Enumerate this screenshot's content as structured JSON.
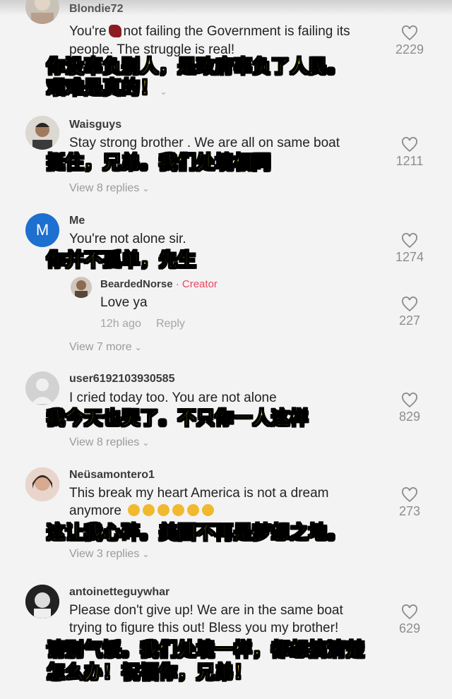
{
  "comments": [
    {
      "username": "Blondie72",
      "text_line1_before": "You're",
      "text_line1_after": "not failing the Government is failing its",
      "text_line2": "people. The struggle is real!",
      "likes": "2229",
      "subtitle_line1": "你没辜负别人，是政府辜负了人民。",
      "subtitle_line2": "艰难是真的！"
    },
    {
      "username": "Waisguys",
      "text_line1": "Stay strong brother . We are all on same boat",
      "likes": "1211",
      "replies_label": "View 8 replies",
      "subtitle_line1": "挺住，兄弟。我们处境相同"
    },
    {
      "username": "Me",
      "avatar_letter": "M",
      "text_line1": "You're not alone sir.",
      "likes": "1274",
      "subtitle_line1": "你并不孤单，先生",
      "reply": {
        "username": "BeardedNorse",
        "separator": " · ",
        "creator_label": "Creator",
        "text": "Love ya",
        "time": "12h ago",
        "reply_action": "Reply",
        "likes": "227"
      },
      "replies_label": "View 7 more"
    },
    {
      "username": "user6192103930585",
      "text_line1": "I cried today too. You are not alone",
      "likes": "829",
      "replies_label": "View 8 replies",
      "subtitle_line1": "我今天也哭了。不只你一人这样"
    },
    {
      "username": "Neüsamontero1",
      "text_line1": "This break my heart America is not a dream",
      "text_line2": "anymore",
      "likes": "273",
      "replies_label": "View 3 replies",
      "subtitle_line1": "这让我心碎。美国不再是梦想之地。"
    },
    {
      "username": "antoinetteguywhar",
      "text_line1": "Please don't give up! We are in the same boat",
      "text_line2": "trying to figure this out! Bless you my brother!",
      "likes": "629",
      "subtitle_line1": "请别气馁。我们处境一样，都想搞清楚",
      "subtitle_line2": "怎么办！祝福你，兄弟！"
    }
  ],
  "colors": {
    "background": "#f3f3f3",
    "subtitle": "#ffe61a",
    "creator": "#e8465e",
    "avatar_me": "#1d6fd0"
  },
  "icons": {
    "like": "heart-outline-icon",
    "expand": "chevron-down-icon"
  }
}
